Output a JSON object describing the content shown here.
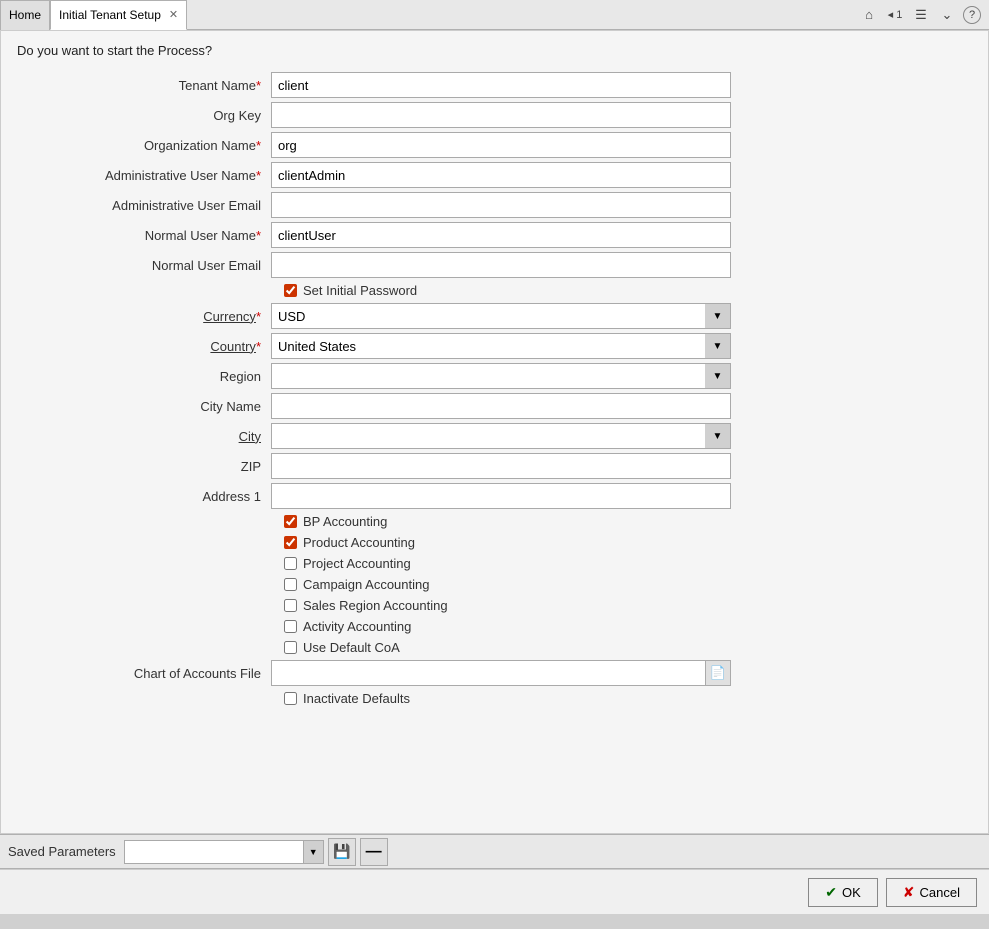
{
  "tabs": [
    {
      "id": "home",
      "label": "Home",
      "active": false
    },
    {
      "id": "initial-tenant-setup",
      "label": "Initial Tenant Setup",
      "active": true
    }
  ],
  "titleBarIcons": [
    {
      "name": "home-icon",
      "symbol": "⌂"
    },
    {
      "name": "back-icon",
      "symbol": "◂1"
    },
    {
      "name": "menu-icon",
      "symbol": "☰"
    },
    {
      "name": "expand-icon",
      "symbol": "⌄"
    },
    {
      "name": "help-icon",
      "symbol": "?"
    }
  ],
  "processQuestion": "Do you want to start the Process?",
  "form": {
    "tenantName": {
      "label": "Tenant Name",
      "required": true,
      "value": "client",
      "placeholder": ""
    },
    "orgKey": {
      "label": "Org Key",
      "required": false,
      "value": "",
      "placeholder": ""
    },
    "organizationName": {
      "label": "Organization Name",
      "required": true,
      "value": "org",
      "placeholder": ""
    },
    "adminUserName": {
      "label": "Administrative User Name",
      "required": true,
      "value": "clientAdmin",
      "placeholder": ""
    },
    "adminUserEmail": {
      "label": "Administrative User Email",
      "required": false,
      "value": "",
      "placeholder": ""
    },
    "normalUserName": {
      "label": "Normal User Name",
      "required": true,
      "value": "clientUser",
      "placeholder": ""
    },
    "normalUserEmail": {
      "label": "Normal User Email",
      "required": false,
      "value": "",
      "placeholder": ""
    },
    "setInitialPassword": {
      "label": "Set Initial Password",
      "checked": true
    },
    "currency": {
      "label": "Currency",
      "required": true,
      "value": "USD",
      "options": [
        "USD"
      ]
    },
    "country": {
      "label": "Country",
      "required": true,
      "value": "United States",
      "options": [
        "United States"
      ]
    },
    "region": {
      "label": "Region",
      "required": false,
      "value": "",
      "options": []
    },
    "cityName": {
      "label": "City Name",
      "required": false,
      "value": "",
      "placeholder": ""
    },
    "city": {
      "label": "City",
      "required": false,
      "value": "",
      "options": []
    },
    "zip": {
      "label": "ZIP",
      "required": false,
      "value": "",
      "placeholder": ""
    },
    "address1": {
      "label": "Address 1",
      "required": false,
      "value": "",
      "placeholder": ""
    },
    "checkboxes": [
      {
        "id": "bp-accounting",
        "label": "BP Accounting",
        "checked": true
      },
      {
        "id": "product-accounting",
        "label": "Product Accounting",
        "checked": true
      },
      {
        "id": "project-accounting",
        "label": "Project Accounting",
        "checked": false
      },
      {
        "id": "campaign-accounting",
        "label": "Campaign Accounting",
        "checked": false
      },
      {
        "id": "sales-region-accounting",
        "label": "Sales Region Accounting",
        "checked": false
      },
      {
        "id": "activity-accounting",
        "label": "Activity Accounting",
        "checked": false
      },
      {
        "id": "use-default-coa",
        "label": "Use Default CoA",
        "checked": false
      }
    ],
    "chartOfAccountsFile": {
      "label": "Chart of Accounts File",
      "value": "",
      "placeholder": ""
    },
    "inactivateDefaults": {
      "label": "Inactivate Defaults",
      "checked": false
    }
  },
  "savedParams": {
    "label": "Saved Parameters",
    "value": "",
    "saveIconSymbol": "💾",
    "deleteIconSymbol": "—"
  },
  "buttons": {
    "ok": "OK",
    "cancel": "Cancel"
  }
}
